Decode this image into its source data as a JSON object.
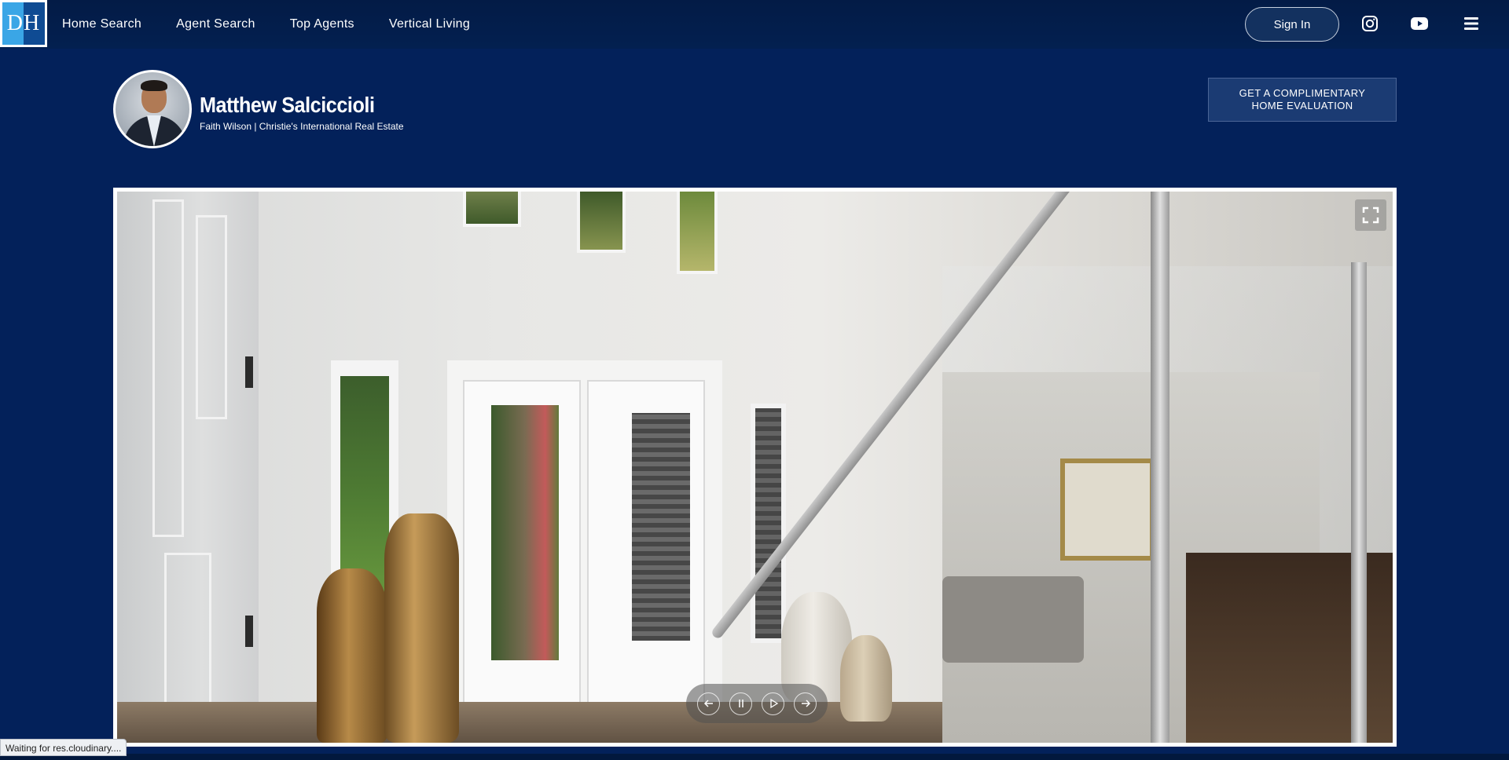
{
  "logo": {
    "text": "DH"
  },
  "nav": {
    "links": [
      "Home Search",
      "Agent Search",
      "Top Agents",
      "Vertical Living"
    ],
    "sign_in": "Sign In"
  },
  "agent": {
    "name": "Matthew Salciccioli",
    "subtitle": "Faith Wilson | Christie's International Real Estate"
  },
  "cta": {
    "line1": "GET A COMPLIMENTARY",
    "line2": "HOME EVALUATION"
  },
  "status_bar": "Waiting for res.cloudinary....",
  "colors": {
    "page_bg": "#03215a",
    "nav_bg": "#031b46",
    "button_bg": "#1b3b73"
  }
}
